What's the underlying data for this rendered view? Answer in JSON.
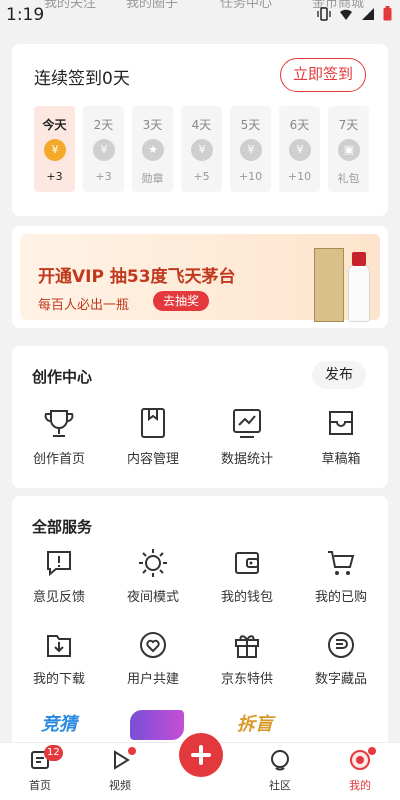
{
  "status": {
    "time": "1:19"
  },
  "top_tabs": [
    "我的关注",
    "我的圈子",
    "任务中心",
    "金币商城"
  ],
  "checkin": {
    "title": "连续签到0天",
    "button": "立即签到",
    "days": [
      {
        "label": "今天",
        "reward": "+3",
        "icon": "coin-icon",
        "active": true
      },
      {
        "label": "2天",
        "reward": "+3",
        "icon": "coin-icon"
      },
      {
        "label": "3天",
        "reward": "勋章",
        "icon": "medal-icon"
      },
      {
        "label": "4天",
        "reward": "+5",
        "icon": "coin-icon"
      },
      {
        "label": "5天",
        "reward": "+10",
        "icon": "coin-icon"
      },
      {
        "label": "6天",
        "reward": "+10",
        "icon": "coin-icon"
      },
      {
        "label": "7天",
        "reward": "礼包",
        "icon": "gift-icon"
      }
    ]
  },
  "banner": {
    "title": "开通VIP 抽53度飞天茅台",
    "subtitle": "每百人必出一瓶",
    "cta": "去抽奖"
  },
  "creator": {
    "title": "创作中心",
    "publish": "发布",
    "items": [
      {
        "label": "创作首页",
        "icon": "trophy-icon"
      },
      {
        "label": "内容管理",
        "icon": "bookmark-icon"
      },
      {
        "label": "数据统计",
        "icon": "chart-icon"
      },
      {
        "label": "草稿箱",
        "icon": "drafts-icon"
      }
    ]
  },
  "services": {
    "title": "全部服务",
    "items": [
      {
        "label": "意见反馈",
        "icon": "feedback-icon"
      },
      {
        "label": "夜间模式",
        "icon": "sun-icon"
      },
      {
        "label": "我的钱包",
        "icon": "wallet-icon"
      },
      {
        "label": "我的已购",
        "icon": "cart-icon"
      },
      {
        "label": "我的下载",
        "icon": "download-icon"
      },
      {
        "label": "用户共建",
        "icon": "heart-icon"
      },
      {
        "label": "京东特供",
        "icon": "gift-box-icon"
      },
      {
        "label": "数字藏品",
        "icon": "collectible-icon"
      }
    ],
    "promos": [
      "竞猜",
      "",
      "拆盲"
    ]
  },
  "tabbar": {
    "items": [
      "首页",
      "视频",
      "",
      "社区",
      "我的"
    ],
    "home_badge": "12",
    "active": "我的"
  },
  "colors": {
    "accent": "#e4393c",
    "coin": "#f4a92a",
    "background": "#f2f2f2"
  }
}
